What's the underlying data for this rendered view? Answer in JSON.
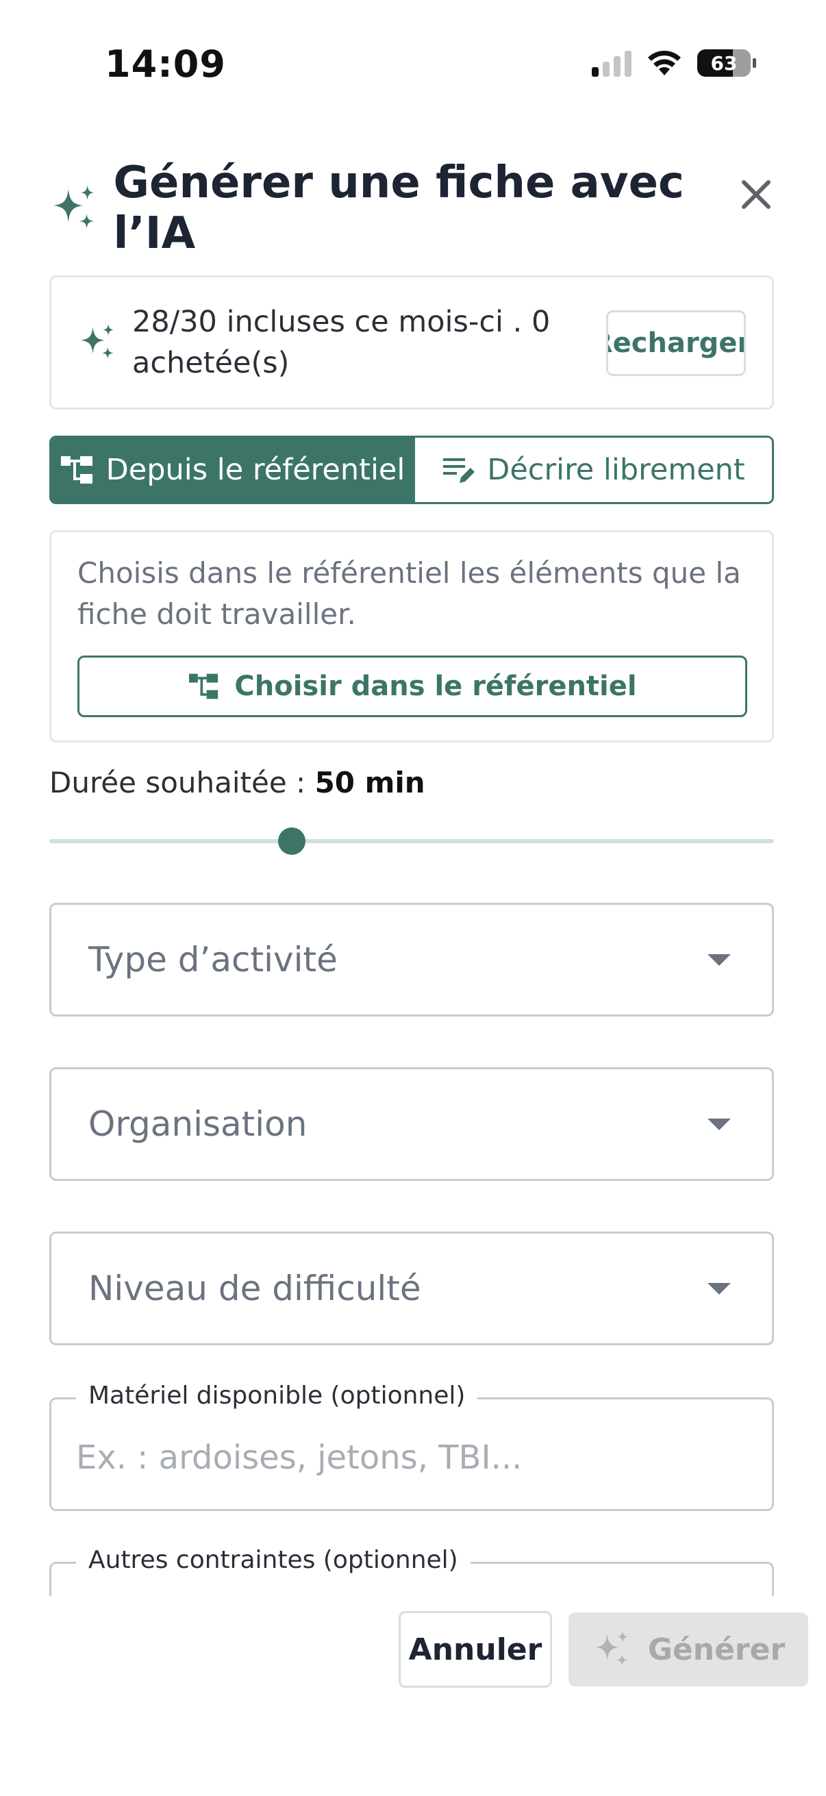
{
  "status_bar": {
    "time": "14:09",
    "battery": "63"
  },
  "dialog": {
    "title": "Générer une fiche avec l’IA",
    "credits": {
      "text": "28/30 incluses ce mois-ci . 0 achetée(s)",
      "recharge_label": "Recharger"
    },
    "tabs": [
      {
        "label": "Depuis le référentiel",
        "active": true
      },
      {
        "label": "Décrire librement",
        "active": false
      }
    ],
    "referentiel": {
      "description": "Choisis dans le référentiel les éléments que la fiche doit travailler.",
      "button_label": "Choisir dans le référentiel"
    },
    "duration": {
      "label": "Durée souhaitée : ",
      "value": "50 min",
      "slider_fraction": 0.335
    },
    "selects": {
      "activity_type": "Type d’activité",
      "organisation": "Organisation",
      "difficulty": "Niveau de difficulté"
    },
    "fields": {
      "materiel": {
        "label": "Matériel disponible (optionnel)",
        "placeholder": "Ex. : ardoises, jetons, TBI..."
      },
      "contraintes": {
        "label": "Autres contraintes (optionnel)",
        "placeholder": ""
      }
    },
    "footer": {
      "cancel_label": "Annuler",
      "generate_label": "Générer"
    }
  },
  "colors": {
    "accent": "#3c7568",
    "disabled": "#e3e3e3",
    "placeholder": "#6b7280"
  },
  "icons": [
    "sparkle-icon",
    "close-icon",
    "tree-icon",
    "edit-notes-icon",
    "chevron-down-icon",
    "signal-icon",
    "wifi-icon",
    "battery-icon"
  ]
}
